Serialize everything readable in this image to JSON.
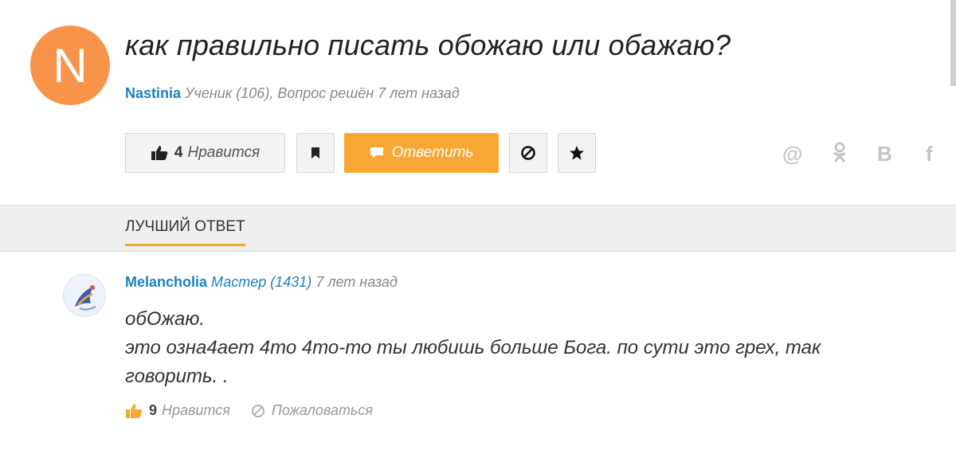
{
  "question": {
    "avatar_letter": "N",
    "title": "как правильно писать обожаю или обажаю?",
    "author": "Nastinia",
    "meta": "Ученик (106), Вопрос решён 7 лет назад",
    "like_count": "4",
    "like_label": "Нравится",
    "answer_label": "Ответить"
  },
  "share": {
    "mail": "@",
    "ok": "ok",
    "vk": "В",
    "fb": "f"
  },
  "section": {
    "tab": "ЛУЧШИЙ ОТВЕТ"
  },
  "answer": {
    "author": "Melancholia",
    "rank": "Мастер (1431)",
    "time": "7 лет назад",
    "line1": "обОжаю.",
    "line2": "это озна4ает 4то 4то-то ты любишь больше Бога. по сути это грех, так говорить. .",
    "like_count": "9",
    "like_label": "Нравится",
    "report_label": "Пожаловаться"
  },
  "colors": {
    "accent": "#f8a732",
    "link": "#1d80c3",
    "avatar": "#f7944a"
  }
}
